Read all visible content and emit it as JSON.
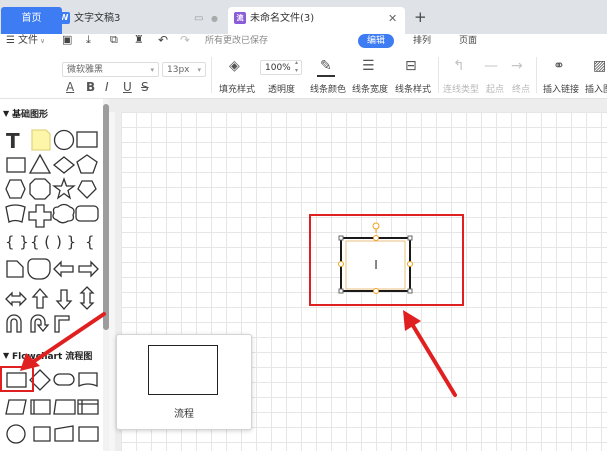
{
  "tabs": [
    {
      "label": "首页",
      "icon": "home-tab"
    },
    {
      "label": "文字文稿3",
      "icon": "writer-doc-icon",
      "icon_char": "W"
    },
    {
      "label": "未命名文件(3)",
      "icon": "flowchart-file-icon",
      "icon_char": "流"
    }
  ],
  "menubar": {
    "file_label": "文件",
    "save_status": "所有更改已保存",
    "tabs": [
      "编辑",
      "排列",
      "页面"
    ],
    "active_tab": "编辑",
    "accent_color": "#3d7cf2"
  },
  "toolbar": {
    "font_name": "微软雅黑",
    "font_size": "13px",
    "zoom": "100%",
    "labels": {
      "fill_style": "填充样式",
      "opacity": "透明度",
      "line_color": "线条颜色",
      "line_width": "线条宽度",
      "line_style": "线条样式",
      "connector_type": "连线类型",
      "start": "起点",
      "end": "终点",
      "insert_link": "插入链接",
      "insert_image": "插入图"
    }
  },
  "sidebar": {
    "basic_section": "基础图形",
    "flowchart_section": "Flowchart 流程图"
  },
  "canvas": {
    "text_cursor": "I",
    "highlight_color": "#e02020"
  },
  "popup": {
    "shape_name": "流程"
  }
}
